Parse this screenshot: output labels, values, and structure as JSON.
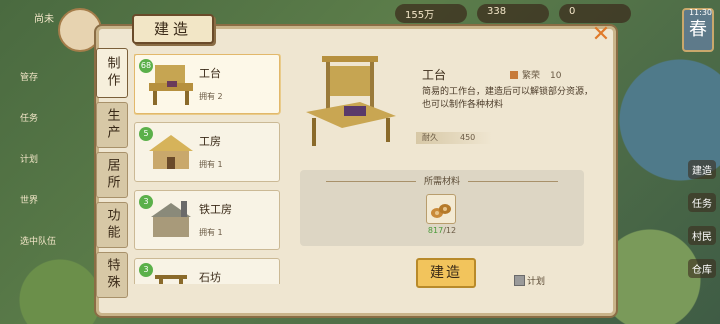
{
  "hud": {
    "top_left": "尚未",
    "money": "155万",
    "resource": "338",
    "count": "0",
    "time": "11:30",
    "season": "春"
  },
  "side_left": [
    "管存",
    "任务",
    "计划",
    "世界",
    "选中队伍"
  ],
  "side_right": [
    "建造",
    "任务",
    "村民",
    "仓库"
  ],
  "panel": {
    "title": "建造",
    "close_icon": "close-icon"
  },
  "tabs": [
    "制作",
    "生产",
    "居所",
    "功能",
    "特殊"
  ],
  "list": [
    {
      "name": "工台",
      "badge": "68",
      "own": "拥有 2"
    },
    {
      "name": "工房",
      "badge": "5",
      "own": "拥有 1"
    },
    {
      "name": "铁工房",
      "badge": "3",
      "own": "拥有 1"
    },
    {
      "name": "石坊",
      "badge": "3",
      "own": ""
    }
  ],
  "detail": {
    "name": "工台",
    "prosper_label": "繁荣",
    "prosper_value": "10",
    "description": "简易的工作台，建造后可以解锁部分资源，也可以制作各种材料",
    "durability_label": "耐久",
    "durability_value": "450"
  },
  "materials": {
    "title": "所需材料",
    "item_icon": "wood-logs-icon",
    "have": "817",
    "need": "/12"
  },
  "build_button": "建造",
  "plan_label": "计划",
  "colors": {
    "accent": "#f2c45c",
    "badge": "#5bb04a",
    "panel": "#efe6d1"
  }
}
